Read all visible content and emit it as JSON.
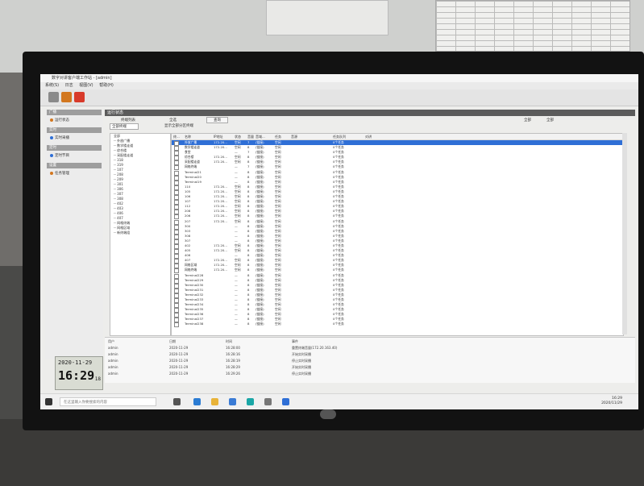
{
  "app": {
    "title": "数字对讲客户端工作站 - [admin]",
    "menu": [
      "系统(S)",
      "日志",
      "视图(V)",
      "帮助(H)"
    ],
    "colors": {
      "accent": "#2f6fd6",
      "header": "#5b5b5b",
      "orange": "#d2771f",
      "red": "#d83a2a"
    }
  },
  "sidebar": {
    "groups": [
      {
        "label": "广播",
        "item": "运行状态"
      },
      {
        "label": "实时",
        "item": "实时采播"
      },
      {
        "label": "定时",
        "item": "定时节目"
      },
      {
        "label": "设置",
        "item": "任务管理"
      }
    ]
  },
  "main": {
    "section_title": "运行状态",
    "tab_label": "终端列表",
    "select_all": "全选",
    "button": "查询",
    "dropdown": "全部终端",
    "hint": "显示全部分区终端",
    "tools": [
      "全部",
      "全部"
    ]
  },
  "tree": [
    "全部",
    "-- 外放广播",
    "-- 数学楼走道",
    "-- 综合楼",
    "-- 采配楼走道",
    "-- 318",
    "-- 319",
    "-- 107",
    "-- 208",
    "-- 209",
    "-- 301",
    "-- 306",
    "-- 307",
    "-- 308",
    "-- 402",
    "-- 403",
    "-- 406",
    "-- 407",
    "-- 网格终端",
    "-- 网格区域",
    "-- 新终端组"
  ],
  "table": {
    "columns": [
      "终...",
      "名称",
      "IP地址",
      "状态",
      "音量",
      "音域...",
      "任务",
      "音源",
      "任务队列",
      "对讲"
    ],
    "rows": [
      [
        "外放广播",
        "172.20...",
        "空闲",
        "7",
        "(链接)",
        "空闲",
        "",
        "0个任务"
      ],
      [
        "数学楼走道",
        "172.20...",
        "空闲",
        "8",
        "(链接)",
        "空闲",
        "",
        "0个任务"
      ],
      [
        "食堂",
        "",
        "—",
        "7",
        "(链接)",
        "空闲",
        "",
        "0个任务"
      ],
      [
        "综合楼",
        "172.20...",
        "空闲",
        "8",
        "(链接)",
        "空闲",
        "",
        "0个任务"
      ],
      [
        "采配楼走道",
        "172.20...",
        "空闲",
        "8",
        "(链接)",
        "空闲",
        "",
        "0个任务"
      ],
      [
        "网格终端",
        "",
        "—",
        "7",
        "(链接)",
        "空闲",
        "",
        "0个任务"
      ],
      [
        "Terminal21",
        "",
        "—",
        "8",
        "(链接)",
        "空闲",
        "",
        "0个任务"
      ],
      [
        "Terminal20",
        "",
        "—",
        "8",
        "(链接)",
        "空闲",
        "",
        "0个任务"
      ],
      [
        "Terminal19",
        "",
        "—",
        "8",
        "(链接)",
        "空闲",
        "",
        "0个任务"
      ],
      [
        "110",
        "172.20...",
        "空闲",
        "8",
        "(链接)",
        "空闲",
        "",
        "0个任务"
      ],
      [
        "105",
        "172.20...",
        "空闲",
        "8",
        "(链接)",
        "空闲",
        "",
        "0个任务"
      ],
      [
        "106",
        "172.20...",
        "空闲",
        "8",
        "(链接)",
        "空闲",
        "",
        "0个任务"
      ],
      [
        "107",
        "172.20...",
        "空闲",
        "8",
        "(链接)",
        "空闲",
        "",
        "0个任务"
      ],
      [
        "112",
        "172.20...",
        "空闲",
        "8",
        "(链接)",
        "空闲",
        "",
        "0个任务"
      ],
      [
        "208",
        "172.20...",
        "空闲",
        "8",
        "(链接)",
        "空闲",
        "",
        "0个任务"
      ],
      [
        "206",
        "172.20...",
        "空闲",
        "8",
        "(链接)",
        "空闲",
        "",
        "0个任务"
      ],
      [
        "207",
        "172.20...",
        "空闲",
        "8",
        "(链接)",
        "空闲",
        "",
        "0个任务"
      ],
      [
        "300",
        "",
        "—",
        "8",
        "(链接)",
        "空闲",
        "",
        "0个任务"
      ],
      [
        "303",
        "",
        "—",
        "8",
        "(链接)",
        "空闲",
        "",
        "0个任务"
      ],
      [
        "308",
        "",
        "—",
        "8",
        "(链接)",
        "空闲",
        "",
        "0个任务"
      ],
      [
        "307",
        "",
        "—",
        "8",
        "(链接)",
        "空闲",
        "",
        "0个任务"
      ],
      [
        "402",
        "172.20...",
        "空闲",
        "8",
        "(链接)",
        "空闲",
        "",
        "0个任务"
      ],
      [
        "405",
        "172.20...",
        "空闲",
        "8",
        "(链接)",
        "空闲",
        "",
        "0个任务"
      ],
      [
        "406",
        "",
        "—",
        "8",
        "(链接)",
        "空闲",
        "",
        "0个任务"
      ],
      [
        "407",
        "172.20...",
        "空闲",
        "8",
        "(链接)",
        "空闲",
        "",
        "0个任务"
      ],
      [
        "网格区域",
        "172.20...",
        "空闲",
        "8",
        "(链接)",
        "空闲",
        "",
        "0个任务"
      ],
      [
        "网格终端",
        "172.20...",
        "空闲",
        "8",
        "(链接)",
        "空闲",
        "",
        "0个任务"
      ],
      [
        "Terminal228",
        "",
        "—",
        "8",
        "(链接)",
        "空闲",
        "",
        "0个任务"
      ],
      [
        "Terminal229",
        "",
        "—",
        "8",
        "(链接)",
        "空闲",
        "",
        "0个任务"
      ],
      [
        "Terminal230",
        "",
        "—",
        "8",
        "(链接)",
        "空闲",
        "",
        "0个任务"
      ],
      [
        "Terminal231",
        "",
        "—",
        "8",
        "(链接)",
        "空闲",
        "",
        "0个任务"
      ],
      [
        "Terminal232",
        "",
        "—",
        "8",
        "(链接)",
        "空闲",
        "",
        "0个任务"
      ],
      [
        "Terminal233",
        "",
        "—",
        "8",
        "(链接)",
        "空闲",
        "",
        "0个任务"
      ],
      [
        "Terminal234",
        "",
        "—",
        "8",
        "(链接)",
        "空闲",
        "",
        "0个任务"
      ],
      [
        "Terminal235",
        "",
        "—",
        "8",
        "(链接)",
        "空闲",
        "",
        "0个任务"
      ],
      [
        "Terminal236",
        "",
        "—",
        "8",
        "(链接)",
        "空闲",
        "",
        "0个任务"
      ],
      [
        "Terminal237",
        "",
        "—",
        "8",
        "(链接)",
        "空闲",
        "",
        "0个任务"
      ],
      [
        "Terminal238",
        "",
        "—",
        "8",
        "(链接)",
        "空闲",
        "",
        "0个任务"
      ]
    ]
  },
  "log": {
    "columns": [
      "用户",
      "日期",
      "时间",
      "事件"
    ],
    "rows": [
      [
        "admin",
        "2020-11-29",
        "16:28:00",
        "重置终端音量(172.20.163.40)"
      ],
      [
        "admin",
        "2020-11-29",
        "16:28:16",
        "开始实时采播"
      ],
      [
        "admin",
        "2020-11-29",
        "16:28:19",
        "停止实时采播"
      ],
      [
        "admin",
        "2020-11-29",
        "16:28:29",
        "开始实时采播"
      ],
      [
        "admin",
        "2020-11-29",
        "16:29:26",
        "停止实时采播"
      ]
    ]
  },
  "clock": {
    "date": "2020-11-29",
    "time": "16:29",
    "seconds": "18"
  },
  "taskbar": {
    "search_placeholder": "在这里输入你要搜索的内容",
    "time": "16:29",
    "date": "2020/11/29"
  }
}
